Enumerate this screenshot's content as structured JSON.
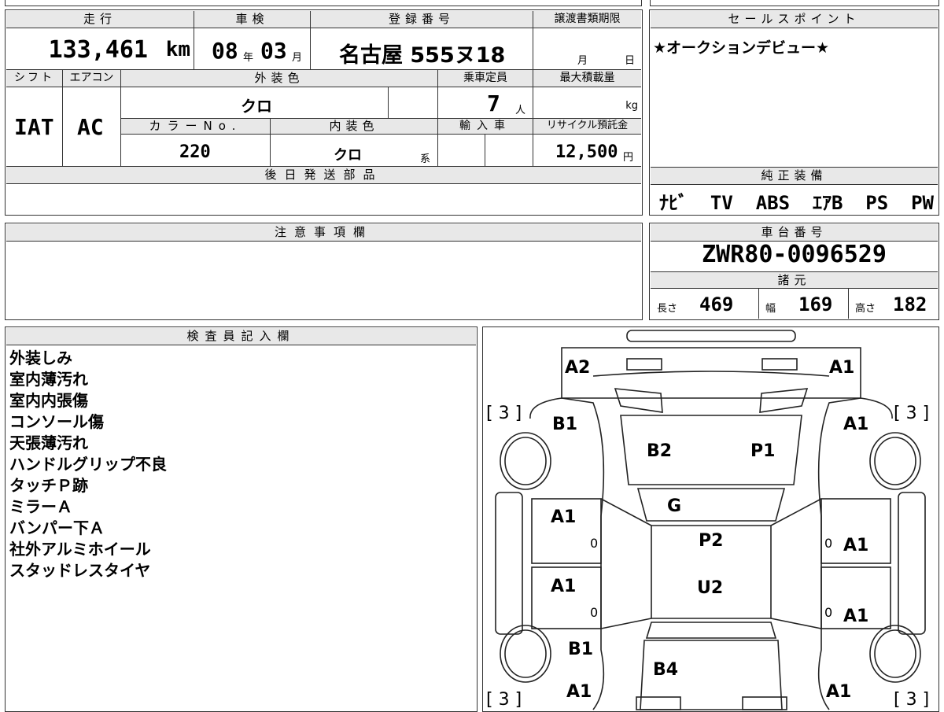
{
  "vehicle_table": {
    "mileage_header": "走行",
    "mileage_value": "133,461",
    "mileage_unit": "km",
    "inspection_header": "車検",
    "inspection_year": "08",
    "inspection_year_unit": "年",
    "inspection_month": "03",
    "inspection_month_unit": "月",
    "registration_header": "登録番号",
    "registration_value": "名古屋 555ヌ18",
    "transfer_header": "譲渡書類期限",
    "transfer_month_unit": "月",
    "transfer_day_unit": "日",
    "shift_header": "シフト",
    "shift_value": "IAT",
    "aircon_header": "エアコン",
    "aircon_value": "AC",
    "exterior_color_header": "外装色",
    "exterior_color_value": "クロ",
    "capacity_header": "乗車定員",
    "capacity_value": "7",
    "capacity_unit": "人",
    "max_load_header": "最大積載量",
    "max_load_unit": "kg",
    "color_no_header": "カラーNo.",
    "color_no_value": "220",
    "interior_color_header": "内装色",
    "interior_color_value": "クロ",
    "interior_color_suffix": "系",
    "import_header": "輸入車",
    "recycle_header": "リサイクル預託金",
    "recycle_value": "12,500",
    "recycle_unit": "円",
    "later_parts_header": "後日発送部品"
  },
  "sales_point": {
    "header": "セールスポイント",
    "text": "★オークションデビュー★"
  },
  "genuine_equipment": {
    "header": "純正装備",
    "items": "ﾅﾋﾞ  TV  ABS  ｴｱB  PS  PW"
  },
  "notes": {
    "header": "注意事項欄"
  },
  "chassis": {
    "header": "車台番号",
    "value": "ZWR80-0096529",
    "spec_header": "諸元",
    "length_label": "長さ",
    "length_value": "469",
    "width_label": "幅",
    "width_value": "169",
    "height_label": "高さ",
    "height_value": "182"
  },
  "inspector": {
    "header": "検査員記入欄",
    "lines": [
      "外装しみ",
      "室内薄汚れ",
      "室内内張傷",
      "コンソール傷",
      "天張薄汚れ",
      "ハンドルグリップ不良",
      "タッチＰ跡",
      "ミラーＡ",
      "バンパー下Ａ",
      "社外アルミホイール",
      "スタッドレスタイヤ"
    ]
  },
  "diagram": {
    "tire_tl": "[ 3 ]",
    "tire_tr": "[ 3 ]",
    "tire_bl": "[ 3 ]",
    "tire_br": "[ 3 ]",
    "marks": {
      "front_left_corner": "A2",
      "front_right_corner": "A1",
      "left_front_fender": "B1",
      "right_front_fender": "A1",
      "hood_left": "B2",
      "hood_right": "P1",
      "windshield": "G",
      "left_front_door": "A1",
      "right_front_door": "A1",
      "roof_front": "P2",
      "left_rear_door": "A1",
      "right_rear_door": "A1",
      "roof_rear": "U2",
      "left_rear_fender": "B1",
      "rear_panel": "B4",
      "left_rear_corner": "A1",
      "right_rear_corner": "A1",
      "door_mark_1": "0",
      "door_mark_2": "0",
      "door_mark_3": "0",
      "door_mark_4": "0"
    }
  }
}
